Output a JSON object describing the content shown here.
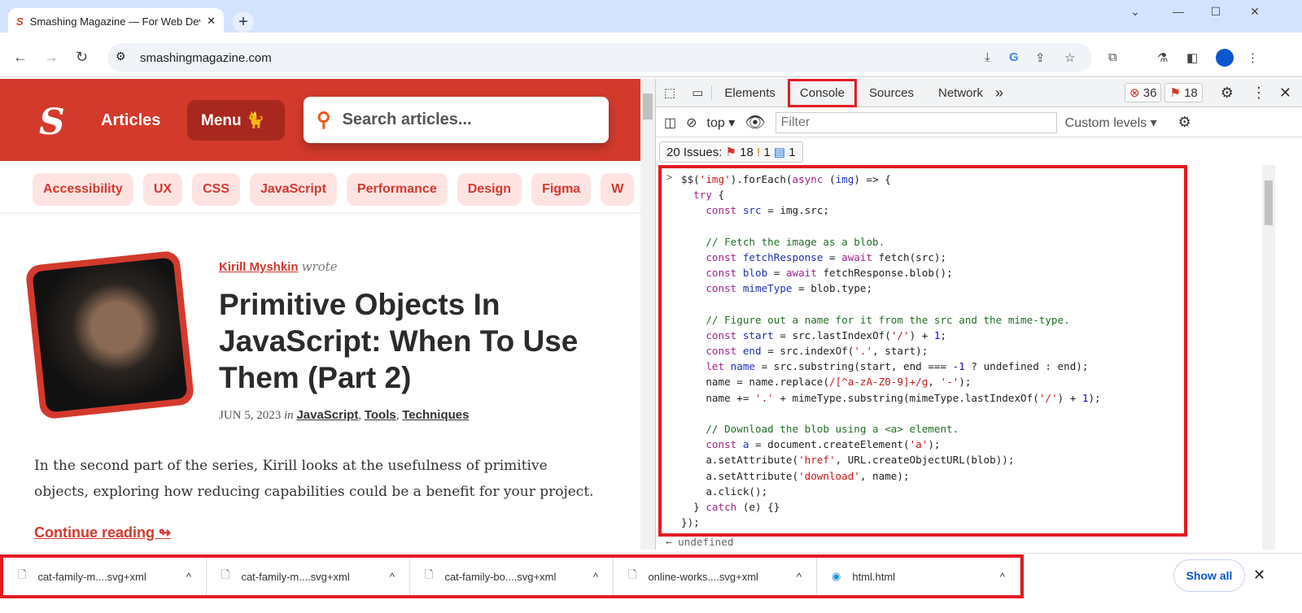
{
  "browser": {
    "tab_title": "Smashing Magazine — For Web Developers",
    "url": "smashingmagazine.com",
    "new_tab": "+",
    "close": "✕"
  },
  "site": {
    "logo": "S",
    "articles": "Articles",
    "menu": "Menu",
    "search_placeholder": "Search articles...",
    "brand_color": "#d33a2c",
    "tags": [
      "Accessibility",
      "UX",
      "CSS",
      "JavaScript",
      "Performance",
      "Design",
      "Figma",
      "W"
    ],
    "article": {
      "author": "Kirill Myshkin",
      "wrote": "wrote",
      "title": "Primitive Objects In JavaScript: When To Use Them (Part 2)",
      "date": "JUN 5, 2023",
      "in": "in",
      "categories": [
        "JavaScript",
        "Tools",
        "Techniques"
      ],
      "excerpt": "In the second part of the series, Kirill looks at the usefulness of primitive objects, exploring how reducing capabilities could be a benefit for your project.",
      "continue": "Continue reading ↬"
    }
  },
  "devtools": {
    "tabs": [
      "Elements",
      "Console",
      "Sources",
      "Network"
    ],
    "more": "»",
    "errors": "36",
    "issues_badge": "18",
    "context": "top",
    "filter_placeholder": "Filter",
    "levels": "Custom levels ▾",
    "issues": {
      "label": "20 Issues:",
      "errors": "18",
      "warnings": "1",
      "info": "1"
    },
    "prompt": ">",
    "result": "← undefined",
    "code": [
      [
        [
          "p",
          "$$("
        ],
        [
          "s",
          "'img'"
        ],
        [
          "p",
          ").forEach("
        ],
        [
          "k",
          "async"
        ],
        [
          "p",
          " ("
        ],
        [
          "v",
          "img"
        ],
        [
          "p",
          ") => {"
        ]
      ],
      [
        [
          "p",
          "  "
        ],
        [
          "k",
          "try"
        ],
        [
          "p",
          " {"
        ]
      ],
      [
        [
          "p",
          "    "
        ],
        [
          "k",
          "const"
        ],
        [
          "v",
          " src"
        ],
        [
          "p",
          " = img.src;"
        ]
      ],
      [],
      [
        [
          "c",
          "    // Fetch the image as a blob."
        ]
      ],
      [
        [
          "p",
          "    "
        ],
        [
          "k",
          "const"
        ],
        [
          "v",
          " fetchResponse"
        ],
        [
          "p",
          " = "
        ],
        [
          "k",
          "await"
        ],
        [
          "p",
          " fetch(src);"
        ]
      ],
      [
        [
          "p",
          "    "
        ],
        [
          "k",
          "const"
        ],
        [
          "v",
          " blob"
        ],
        [
          "p",
          " = "
        ],
        [
          "k",
          "await"
        ],
        [
          "p",
          " fetchResponse.blob();"
        ]
      ],
      [
        [
          "p",
          "    "
        ],
        [
          "k",
          "const"
        ],
        [
          "v",
          " mimeType"
        ],
        [
          "p",
          " = blob.type;"
        ]
      ],
      [],
      [
        [
          "c",
          "    // Figure out a name for it from the src and the mime-type."
        ]
      ],
      [
        [
          "p",
          "    "
        ],
        [
          "k",
          "const"
        ],
        [
          "v",
          " start"
        ],
        [
          "p",
          " = src.lastIndexOf("
        ],
        [
          "s",
          "'/'"
        ],
        [
          "p",
          ") + "
        ],
        [
          "n",
          "1"
        ],
        [
          "p",
          ";"
        ]
      ],
      [
        [
          "p",
          "    "
        ],
        [
          "k",
          "const"
        ],
        [
          "v",
          " end"
        ],
        [
          "p",
          " = src.indexOf("
        ],
        [
          "s",
          "'.'"
        ],
        [
          "p",
          ", start);"
        ]
      ],
      [
        [
          "p",
          "    "
        ],
        [
          "k",
          "let"
        ],
        [
          "v",
          " name"
        ],
        [
          "p",
          " = src.substring(start, end === "
        ],
        [
          "n",
          "-1"
        ],
        [
          "p",
          " ? undefined : end);"
        ]
      ],
      [
        [
          "p",
          "    name = name.replace("
        ],
        [
          "s",
          "/[^a-zA-Z0-9]+/g"
        ],
        [
          "p",
          ", "
        ],
        [
          "s",
          "'-'"
        ],
        [
          "p",
          ");"
        ]
      ],
      [
        [
          "p",
          "    name += "
        ],
        [
          "s",
          "'.'"
        ],
        [
          "p",
          " + mimeType.substring(mimeType.lastIndexOf("
        ],
        [
          "s",
          "'/'"
        ],
        [
          "p",
          ") + "
        ],
        [
          "n",
          "1"
        ],
        [
          "p",
          ");"
        ]
      ],
      [],
      [
        [
          "c",
          "    // Download the blob using a <a> element."
        ]
      ],
      [
        [
          "p",
          "    "
        ],
        [
          "k",
          "const"
        ],
        [
          "v",
          " a"
        ],
        [
          "p",
          " = document.createElement("
        ],
        [
          "s",
          "'a'"
        ],
        [
          "p",
          ");"
        ]
      ],
      [
        [
          "p",
          "    a.setAttribute("
        ],
        [
          "s",
          "'href'"
        ],
        [
          "p",
          ", URL.createObjectURL(blob));"
        ]
      ],
      [
        [
          "p",
          "    a.setAttribute("
        ],
        [
          "s",
          "'download'"
        ],
        [
          "p",
          ", name);"
        ]
      ],
      [
        [
          "p",
          "    a.click();"
        ]
      ],
      [
        [
          "p",
          "  } "
        ],
        [
          "k",
          "catch"
        ],
        [
          "p",
          " (e) {}"
        ]
      ],
      [
        [
          "p",
          "});"
        ]
      ]
    ]
  },
  "downloads": {
    "items": [
      {
        "name": "cat-family-m....svg+xml",
        "icon": "file-icon"
      },
      {
        "name": "cat-family-m....svg+xml",
        "icon": "file-icon"
      },
      {
        "name": "cat-family-bo....svg+xml",
        "icon": "file-icon"
      },
      {
        "name": "online-works....svg+xml",
        "icon": "file-icon"
      },
      {
        "name": "html.html",
        "icon": "edge-icon"
      }
    ],
    "show_all": "Show all",
    "close": "✕",
    "expand": "^"
  }
}
